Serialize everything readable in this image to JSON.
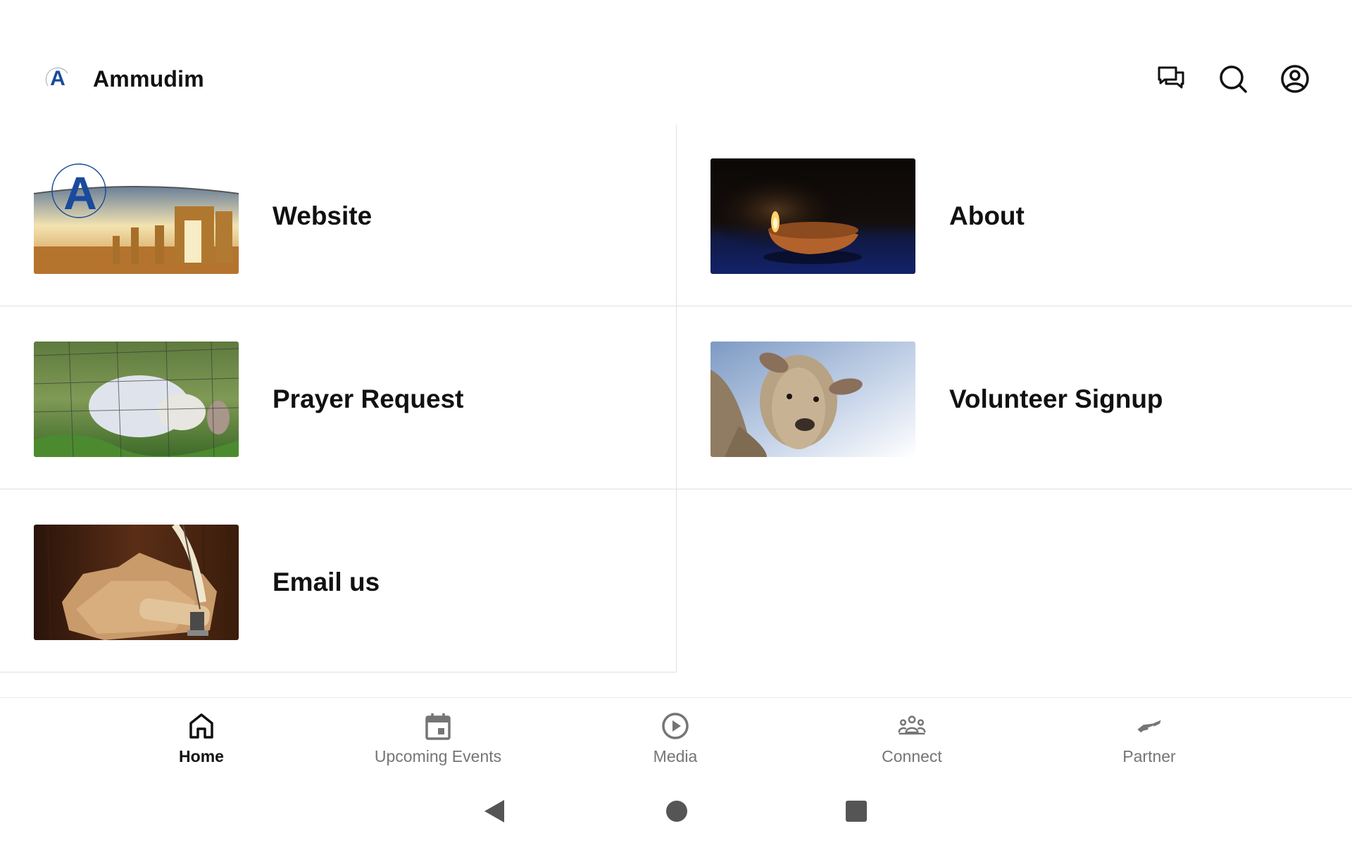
{
  "app": {
    "title": "Ammudim",
    "logo_letter": "A"
  },
  "header": {
    "actions": [
      {
        "name": "chat",
        "icon": "chat-icon"
      },
      {
        "name": "search",
        "icon": "search-icon"
      },
      {
        "name": "profile",
        "icon": "account-icon"
      }
    ]
  },
  "tiles": [
    {
      "label": "Website",
      "image": "ruins-with-logo"
    },
    {
      "label": "About",
      "image": "oil-lamp"
    },
    {
      "label": "Prayer Request",
      "image": "sheep-in-field"
    },
    {
      "label": "Volunteer Signup",
      "image": "sheep-closeup"
    },
    {
      "label": "Email us",
      "image": "quill-and-scroll"
    }
  ],
  "bottom_nav": {
    "items": [
      {
        "label": "Home",
        "icon": "home-icon",
        "active": true
      },
      {
        "label": "Upcoming Events",
        "icon": "calendar-icon",
        "active": false
      },
      {
        "label": "Media",
        "icon": "play-circle-icon",
        "active": false
      },
      {
        "label": "Connect",
        "icon": "people-icon",
        "active": false
      },
      {
        "label": "Partner",
        "icon": "handshake-icon",
        "active": false
      }
    ]
  },
  "system_nav": {
    "buttons": [
      "back",
      "home",
      "recents"
    ]
  },
  "colors": {
    "brand_blue": "#1a4a9c",
    "active": "#111111",
    "inactive": "#757575",
    "divider": "#e0e0e0"
  }
}
